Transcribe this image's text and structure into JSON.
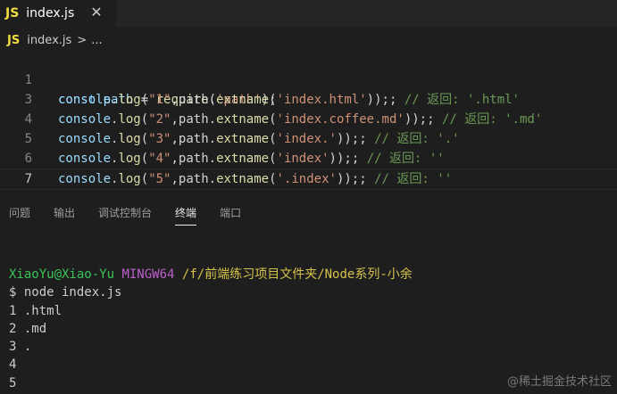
{
  "tab": {
    "badge": "JS",
    "label": "index.js",
    "close": "✕"
  },
  "breadcrumb": {
    "badge": "JS",
    "file": "index.js",
    "sep": ">",
    "more": "..."
  },
  "editor": {
    "line_numbers": [
      "1",
      "",
      "3",
      "4",
      "5",
      "6",
      "7"
    ],
    "line1": {
      "kw": "const",
      "var": "path",
      "eq": " = ",
      "fn": "require",
      "open": "(",
      "str": "'path'",
      "close": ");"
    },
    "calls": [
      {
        "obj": "console",
        "dot": ".",
        "fn": "log",
        "open": "(",
        "arg": "\"1\"",
        "comma": ",path.",
        "method": "extname",
        "p": "(",
        "file": "'index.html'",
        "end": "));",
        "semi": ";",
        "comment": " // 返回: '.html'"
      },
      {
        "obj": "console",
        "dot": ".",
        "fn": "log",
        "open": "(",
        "arg": "\"2\"",
        "comma": ",path.",
        "method": "extname",
        "p": "(",
        "file": "'index.coffee.md'",
        "end": "));",
        "semi": ";",
        "comment": " // 返回: '.md'"
      },
      {
        "obj": "console",
        "dot": ".",
        "fn": "log",
        "open": "(",
        "arg": "\"3\"",
        "comma": ",path.",
        "method": "extname",
        "p": "(",
        "file": "'index.'",
        "end": "));",
        "semi": ";",
        "comment": " // 返回: '.'"
      },
      {
        "obj": "console",
        "dot": ".",
        "fn": "log",
        "open": "(",
        "arg": "\"4\"",
        "comma": ",path.",
        "method": "extname",
        "p": "(",
        "file": "'index'",
        "end": "));",
        "semi": ";",
        "comment": " // 返回: ''"
      },
      {
        "obj": "console",
        "dot": ".",
        "fn": "log",
        "open": "(",
        "arg": "\"5\"",
        "comma": ",path.",
        "method": "extname",
        "p": "(",
        "file": "'.index'",
        "end": "));",
        "semi": ";",
        "comment": " // 返回: ''"
      }
    ]
  },
  "panel": {
    "tabs": [
      "问题",
      "输出",
      "调试控制台",
      "终端",
      "端口"
    ],
    "active": "终端"
  },
  "terminal": {
    "user": "XiaoYu@Xiao-Yu",
    "host": "MINGW64",
    "path": "/f/前端练习项目文件夹/Node系列-小余",
    "command": "$ node index.js",
    "outputs": [
      "1 .html",
      "2 .md",
      "3 .",
      "4",
      "5"
    ]
  },
  "watermark": "@稀土掘金技术社区"
}
